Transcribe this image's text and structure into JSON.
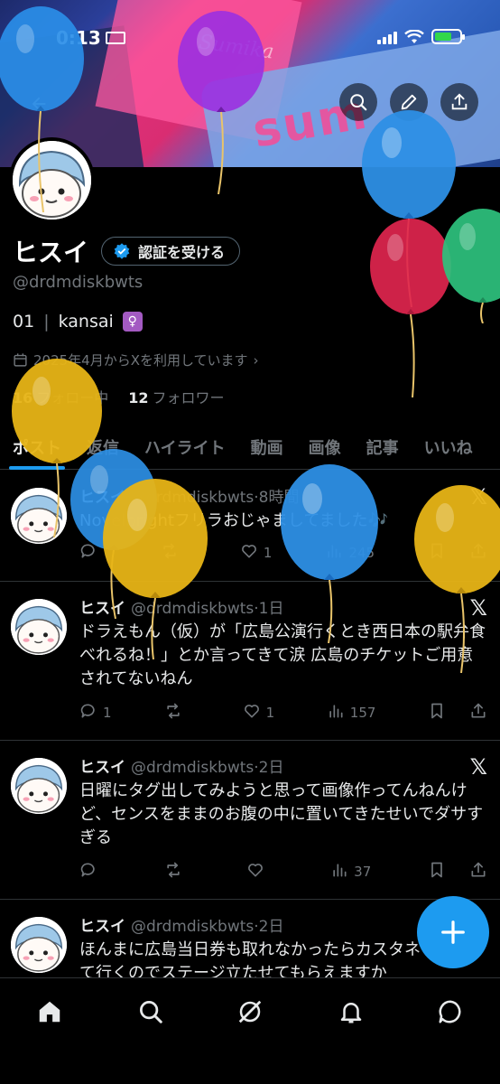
{
  "status": {
    "time": "0:13"
  },
  "profile": {
    "name": "ヒスイ",
    "verify_label": "認証を受ける",
    "handle": "@drdmdiskbwts",
    "bio_number": "01",
    "bio_separator": "|",
    "bio_location": "kansai",
    "joined": "2025年4月からXを利用しています",
    "following_count": "16",
    "following_label": "フォロー中",
    "followers_count": "12",
    "followers_label": "フォロワー"
  },
  "tabs": [
    "ポスト",
    "返信",
    "ハイライト",
    "動画",
    "画像",
    "記事",
    "いいね"
  ],
  "posts": [
    {
      "name": "ヒスイ",
      "handle": "@drdmdiskbwts",
      "time": "8時間",
      "text": "Novelbrightフリラおじゃましてました🎶",
      "replies": "",
      "reposts": "",
      "likes": "1",
      "views": "245"
    },
    {
      "name": "ヒスイ",
      "handle": "@drdmdiskbwts",
      "time": "1日",
      "text": "ドラえもん（仮）が「広島公演行くとき西日本の駅弁食べれるね！」とか言ってきて涙 広島のチケットご用意されてないねん",
      "replies": "1",
      "reposts": "",
      "likes": "1",
      "views": "157"
    },
    {
      "name": "ヒスイ",
      "handle": "@drdmdiskbwts",
      "time": "2日",
      "text": "日曜にタグ出してみようと思って画像作ってんねんけど、センスをままのお腹の中に置いてきたせいでダサすぎる",
      "replies": "",
      "reposts": "",
      "likes": "",
      "views": "37"
    },
    {
      "name": "ヒスイ",
      "handle": "@drdmdiskbwts",
      "time": "2日",
      "text": "ほんまに広島当日券も取れなかったらカスタネット持って行くのでステージ立たせてもらえますか",
      "replies": "",
      "reposts": "",
      "likes": "",
      "views": ""
    }
  ],
  "banner": {
    "wordmark": "sum",
    "script": "Sumika"
  },
  "colors": {
    "accent": "#1d9bf0",
    "text": "#e7e9ea",
    "muted": "#71767b",
    "border": "#2f3336"
  },
  "icons": [
    "back-arrow-icon",
    "search-icon",
    "pencil-icon",
    "share-icon",
    "verified-badge-icon",
    "calendar-icon",
    "x-logo-icon",
    "reply-icon",
    "repost-icon",
    "like-icon",
    "views-icon",
    "bookmark-icon",
    "plus-icon",
    "home-icon",
    "grok-icon",
    "bell-icon",
    "messages-icon",
    "balloon"
  ]
}
